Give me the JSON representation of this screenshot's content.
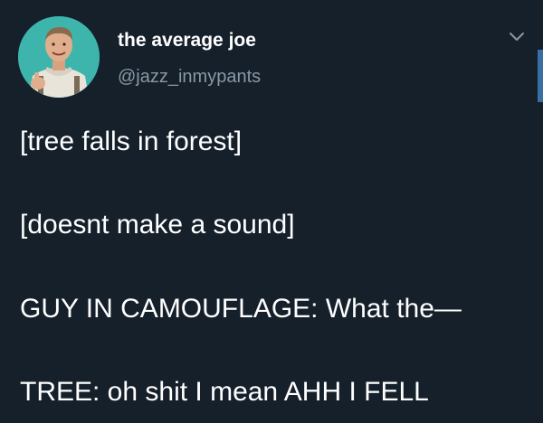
{
  "author": {
    "display_name": "the average joe",
    "handle": "@jazz_inmypants"
  },
  "tweet": {
    "lines": [
      "[tree falls in forest]",
      "[doesnt make a sound]",
      "GUY IN CAMOUFLAGE: What the—",
      "TREE: oh shit I mean AHH I FELL"
    ]
  },
  "colors": {
    "background": "#15202b",
    "primary_text": "#ffffff",
    "secondary_text": "#8899a6",
    "avatar_bg": "#3db5ac",
    "accent": "#3b6ea5"
  },
  "icons": {
    "avatar": "user-avatar-photo",
    "menu": "chevron-down-icon"
  }
}
